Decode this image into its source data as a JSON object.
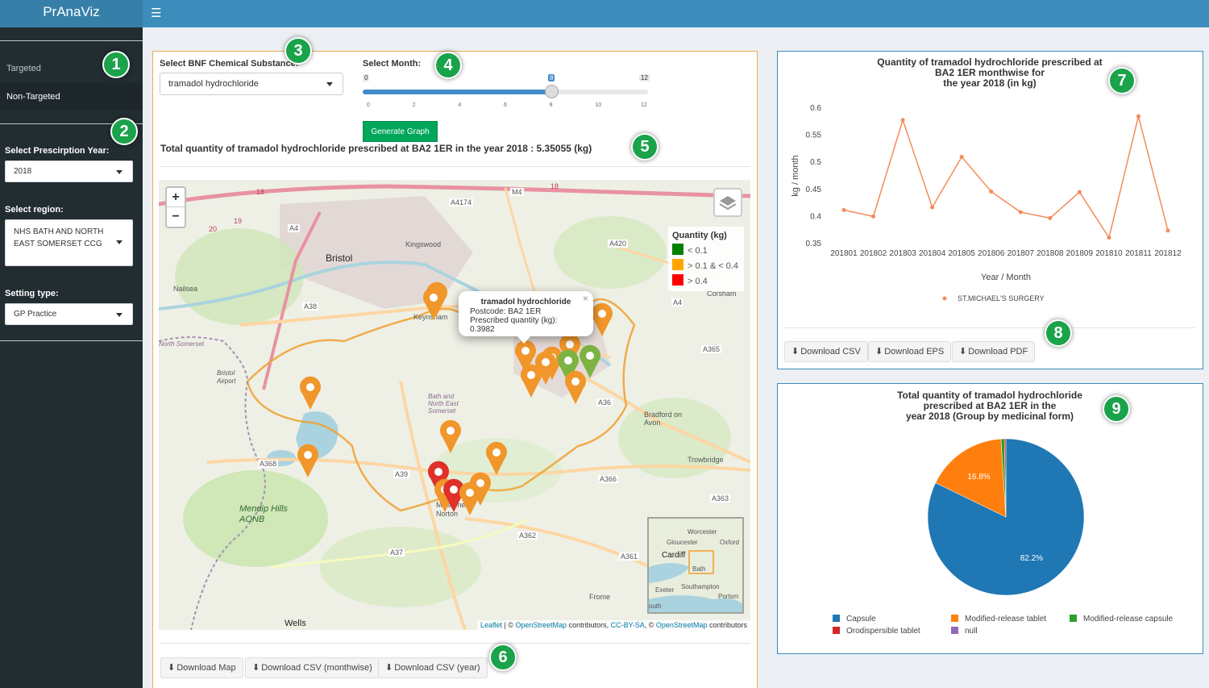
{
  "app": {
    "title": "PrAnaViz"
  },
  "sidebar": {
    "menu": [
      {
        "label": "Targeted"
      },
      {
        "label": "Non-Targeted"
      }
    ],
    "year": {
      "label": "Select Prescirption Year:",
      "value": "2018"
    },
    "region": {
      "label": "Select region:",
      "value": "NHS BATH AND NORTH EAST SOMERSET CCG"
    },
    "setting": {
      "label": "Setting type:",
      "value": "GP Practice"
    }
  },
  "badges": [
    "1",
    "2",
    "3",
    "4",
    "5",
    "6",
    "7",
    "8",
    "9"
  ],
  "controls": {
    "substance_label": "Select BNF Chemical Substance:",
    "substance_value": "tramadol hydrochloride",
    "month_label": "Select Month:",
    "month_min": "0",
    "month_max": "12",
    "month_value": "8",
    "slider_ticks": [
      "0",
      "2",
      "4",
      "6",
      "8",
      "10",
      "12"
    ],
    "generate_label": "Generate Graph"
  },
  "total_text": "Total quantity of tramadol hydrochloride prescribed at BA2 1ER in the year 2018 : 5.35055 (kg)",
  "map": {
    "zoom_in": "+",
    "zoom_out": "−",
    "legend": {
      "title": "Quantity (kg)",
      "items": [
        {
          "label": "< 0.1",
          "color": "#008000"
        },
        {
          "label": "> 0.1 & < 0.4",
          "color": "#ffa500"
        },
        {
          "label": "> 0.4",
          "color": "#ff0000"
        }
      ]
    },
    "popup": {
      "title": "tramadol hydrochloride",
      "postcode": "Postcode: BA2 1ER",
      "quantity": "Prescribed quantity (kg): 0.3982",
      "close": "×"
    },
    "labels": {
      "bristol": "Bristol",
      "nailsea": "Nailsea",
      "kingswood": "Kingswood",
      "keynsham": "Keynsham",
      "corsham": "Corsham",
      "bradford": "Bradford on Avon",
      "trowbridge": "Trowbridge",
      "frome": "Frome",
      "wells": "Wells",
      "mendip": "Mendip Hills AONB",
      "radstock": "Midsomer Norton",
      "airport": "Bristol Airport",
      "bath_ne": "Bath and North East Somerset",
      "nsomerset": "North Somerset",
      "a4174": "A4174",
      "m4": "M4",
      "a420": "A420",
      "a4": "A4",
      "a38": "A38",
      "a365": "A365",
      "a36": "A36",
      "a368": "A368",
      "a39": "A39",
      "a366": "A366",
      "a363": "A363",
      "a362": "A362",
      "a361": "A361",
      "a37": "A37",
      "r18": "18",
      "r19": "19",
      "r20": "20"
    },
    "minimap": {
      "worcester": "Worcester",
      "gloucester": "Gloucester",
      "oxford": "Oxford",
      "cardiff": "Cardiff",
      "bath": "Bath",
      "exeter": "Exeter",
      "southampton": "Southampton",
      "portsmouth": "Portsm",
      "south": "outh"
    },
    "attribution": {
      "leaflet": "Leaflet",
      "sep": " | © ",
      "osm": "OpenStreetMap",
      "contrib": " contributors, ",
      "ccby": "CC-BY-SA",
      "sep2": ", © ",
      "osm2": "OpenStreetMap",
      "contrib2": " contributors"
    }
  },
  "map_buttons": [
    "Download Map",
    "Download CSV (monthwise)",
    "Download CSV (year)"
  ],
  "line_chart": {
    "title_lines": [
      "Quantity of tramadol hydrochloride prescribed at",
      "BA2 1ER monthwise for",
      "the year 2018 (in kg)"
    ],
    "buttons": [
      "Download CSV",
      "Download EPS",
      "Download PDF"
    ]
  },
  "pie_chart": {
    "title_lines": [
      "Total quantity of tramadol hydrochloride",
      "prescribed at BA2 1ER in the",
      "year 2018 (Group by medicinal form)"
    ]
  },
  "chart_data": [
    {
      "type": "line",
      "title": "Quantity of tramadol hydrochloride prescribed at BA2 1ER monthwise for the year 2018 (in kg)",
      "xlabel": "Year / Month",
      "ylabel": "kg / month",
      "categories": [
        "201801",
        "201802",
        "201803",
        "201804",
        "201805",
        "201806",
        "201807",
        "201808",
        "201809",
        "201810",
        "201811",
        "201812"
      ],
      "series": [
        {
          "name": "ST.MICHAEL'S SURGERY",
          "color": "#f48b5a",
          "values": [
            0.412,
            0.4,
            0.578,
            0.417,
            0.51,
            0.446,
            0.408,
            0.397,
            0.445,
            0.361,
            0.585,
            0.374
          ]
        }
      ],
      "yticks": [
        "0.6",
        "0.55",
        "0.5",
        "0.45",
        "0.4",
        "0.35"
      ],
      "ylim": [
        0.35,
        0.6
      ],
      "grid": false,
      "legend": "bottom"
    },
    {
      "type": "pie",
      "title": "Total quantity of tramadol hydrochloride prescribed at BA2 1ER in the year 2018 (Group by medicinal form)",
      "slices": [
        {
          "label": "Capsule",
          "value": 82.2,
          "display": "82.2%",
          "color": "#1f77b4"
        },
        {
          "label": "Modified-release tablet",
          "value": 16.8,
          "display": "16.8%",
          "color": "#ff7f0e"
        },
        {
          "label": "Modified-release capsule",
          "value": 0.7,
          "color": "#2ca02c"
        },
        {
          "label": "Orodispersible tablet",
          "value": 0.3,
          "color": "#d62728"
        },
        {
          "label": "null",
          "value": 0.0,
          "color": "#9467bd"
        }
      ],
      "legend": "bottom"
    }
  ]
}
